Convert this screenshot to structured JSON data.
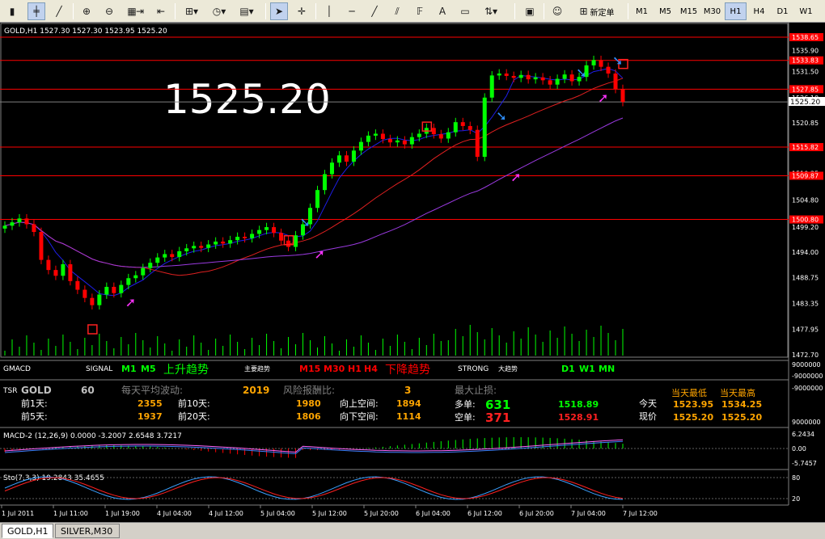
{
  "toolbar": {
    "new_order_label": "新定单",
    "timeframes": [
      "M1",
      "M5",
      "M15",
      "M30",
      "H1",
      "H4",
      "D1",
      "W1"
    ],
    "active_timeframe": "H1"
  },
  "chart": {
    "header": "GOLD,H1  1527.30 1527.30 1523.95 1525.20",
    "big_price": "1525.20",
    "price_axis": [
      "1538.65",
      "1535.90",
      "1533.83",
      "1531.50",
      "1527.85",
      "1526.10",
      "1525.20",
      "1520.85",
      "1515.82",
      "1510.35",
      "1509.87",
      "1504.80",
      "1500.80",
      "1499.20",
      "1494.00",
      "1488.75",
      "1483.35",
      "1477.95",
      "1472.70"
    ],
    "time_axis": [
      "1 Jul 2011",
      "1 Jul 11:00",
      "1 Jul 19:00",
      "4 Jul 04:00",
      "4 Jul 12:00",
      "5 Jul 04:00",
      "5 Jul 12:00",
      "5 Jul 20:00",
      "6 Jul 04:00",
      "6 Jul 12:00",
      "6 Jul 20:00",
      "7 Jul 04:00",
      "7 Jul 12:00"
    ],
    "colors": {
      "bull": "#00ff00",
      "bear": "#ff0000",
      "ma_fast": "#1e1ee8",
      "ma_mid": "#e02020",
      "ma_slow": "#9a3ae0",
      "level": "#ff0000"
    }
  },
  "gmacd": {
    "name": "GMACD",
    "signal_label": "SIGNAL",
    "m1": "M1",
    "m5": "M5",
    "up_trend": "上升趋势",
    "main_trend": "主要趋势",
    "m15": "M15",
    "m30": "M30",
    "h1": "H1",
    "h4": "H4",
    "down_trend": "下降趋势",
    "strong": "STRONG",
    "big_trend": "大趋势",
    "d1": "D1",
    "w1": "W1",
    "mn": "MN",
    "axis_top": "9000000",
    "axis_bottom": "-9000000"
  },
  "tsr": {
    "name": "TSR",
    "symbol": "GOLD",
    "period": "60",
    "avg_label": "每天平均波动:",
    "avg_value": "2019",
    "risk_label": "风险报酬比:",
    "risk_value": "3",
    "maxsl_label": "最大止损:",
    "d1_label": "前1天:",
    "d1_value": "2355",
    "d10_label": "前10天:",
    "d10_value": "1980",
    "up_space_label": "向上空间:",
    "up_space_value": "1894",
    "d5_label": "前5天:",
    "d5_value": "1937",
    "d20_label": "前20天:",
    "d20_value": "1806",
    "down_space_label": "向下空间:",
    "down_space_value": "1114",
    "long_label": "多单:",
    "long_value": "631",
    "long_price": "1518.89",
    "short_label": "空单:",
    "short_value": "371",
    "short_price": "1528.91",
    "today_label": "今天",
    "now_label": "现价",
    "low_label": "当天最低",
    "high_label": "当天最高",
    "today_low": "1523.95",
    "today_high": "1534.25",
    "now_low": "1525.20",
    "now_high": "1525.20",
    "axis_top": "-9000000",
    "axis_bottom": "9000000"
  },
  "macd": {
    "header": "MACD-2 (12,26,9) 0.0000 -3.2007 2.6548 3.7217",
    "axis": [
      "6.2434",
      "0.00",
      "-5.7457"
    ]
  },
  "sto": {
    "header": "Sto(7,3,3) 19.2843 35.4655",
    "axis": [
      "80",
      "20"
    ]
  },
  "tabs": [
    "GOLD,H1",
    "SILVER,M30"
  ]
}
